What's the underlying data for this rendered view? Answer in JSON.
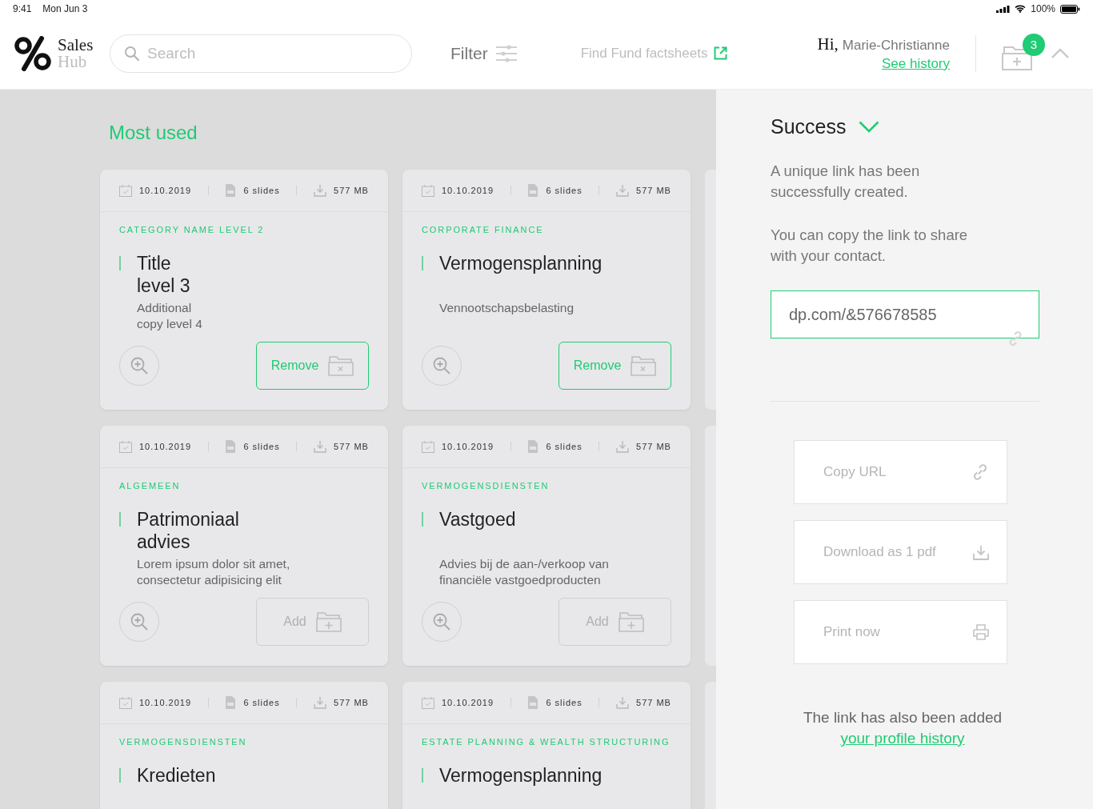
{
  "status_bar": {
    "time": "9:41",
    "date": "Mon Jun 3",
    "battery": "100%"
  },
  "header": {
    "logo_top": "Sales",
    "logo_bottom": "Hub",
    "search": {
      "placeholder": "Search"
    },
    "filter": "Filter",
    "factsheets": "Find Fund factsheets",
    "greeting": "Hi,",
    "user": "Marie-Christianne",
    "history_link": "See history",
    "cart_count": "3"
  },
  "section_title": "Most used",
  "cards": [
    {
      "date": "10.10.2019",
      "slides": "6 slides",
      "size": "577 MB",
      "category": "CATEGORY NAME LEVEL 2",
      "title": "Title\nlevel 3",
      "description": "Additional\ncopy level 4",
      "in_collection": true,
      "action": "Remove"
    },
    {
      "date": "10.10.2019",
      "slides": "6 slides",
      "size": "577 MB",
      "category": "CORPORATE FINANCE",
      "title": "Vermogensplanning",
      "description": "Vennootschapsbelasting",
      "in_collection": true,
      "action": "Remove"
    },
    {
      "date": "10.10.2019",
      "slides": "6 slides",
      "size": "577 MB",
      "category": "ALGEMEEN",
      "title": "Patrimoniaal\nadvies",
      "description": "Lorem ipsum dolor sit amet,\nconsectetur adipisicing elit",
      "in_collection": false,
      "action": "Add"
    },
    {
      "date": "10.10.2019",
      "slides": "6 slides",
      "size": "577 MB",
      "category": "VERMOGENSDIENSTEN",
      "title": "Vastgoed",
      "description": "Advies bij de aan-/verkoop van\nfinanciële vastgoedproducten",
      "in_collection": false,
      "action": "Add"
    },
    {
      "date": "10.10.2019",
      "slides": "6 slides",
      "size": "577 MB",
      "category": "VERMOGENSDIENSTEN",
      "title": "Kredieten"
    },
    {
      "date": "10.10.2019",
      "slides": "6 slides",
      "size": "577 MB",
      "category": "ESTATE PLANNING & WEALTH STRUCTURING",
      "title": "Vermogensplanning"
    }
  ],
  "panel": {
    "title": "Success",
    "message": "A unique link has been\nsuccessfully created.",
    "instruction": "You can copy the link to share\nwith your contact.",
    "link_value": "dp.com/&576678585",
    "actions": [
      {
        "kind": "copy",
        "label": "Copy URL"
      },
      {
        "kind": "download",
        "label": "Download as 1 pdf"
      },
      {
        "kind": "print",
        "label": "Print now"
      }
    ],
    "footer": "The link has also been added",
    "footer_link": "your profile history"
  }
}
